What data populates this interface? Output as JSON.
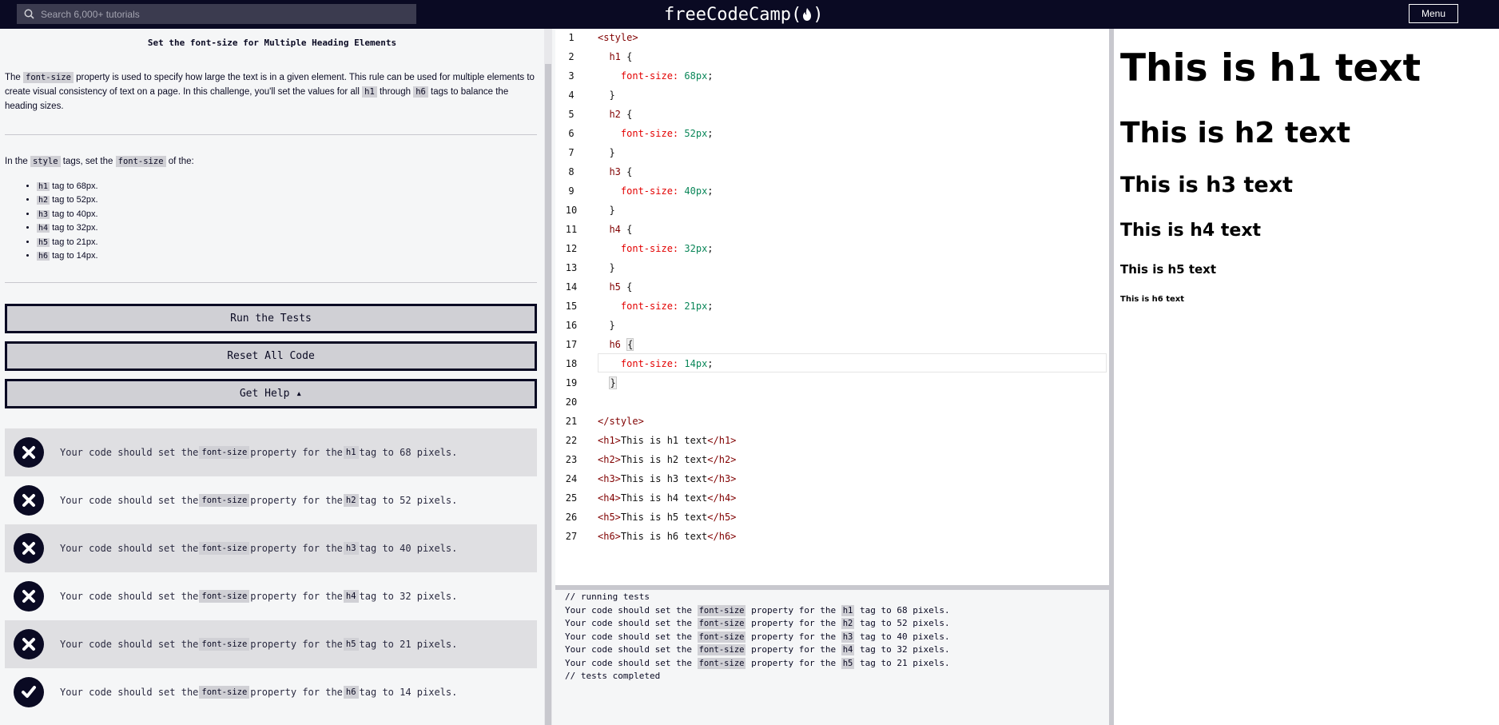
{
  "navbar": {
    "search_placeholder": "Search 6,000+ tutorials",
    "logo_text_left": "freeCodeCamp(",
    "logo_text_right": ")",
    "menu_label": "Menu"
  },
  "challenge": {
    "title": "Set the font-size for Multiple Heading Elements",
    "intro": {
      "t1": "The ",
      "c1": "font-size",
      "t2": " property is used to specify how large the text is in a given element. This rule can be used for multiple elements to create visual consistency of text on a page. In this challenge, you'll set the values for all ",
      "c2": "h1",
      "t3": " through ",
      "c3": "h6",
      "t4": " tags to balance the heading sizes."
    },
    "instruction": {
      "t1": "In the ",
      "c1": "style",
      "t2": " tags, set the ",
      "c2": "font-size",
      "t3": " of the:"
    },
    "tasks": [
      {
        "tag": "h1",
        "text": " tag to 68px."
      },
      {
        "tag": "h2",
        "text": " tag to 52px."
      },
      {
        "tag": "h3",
        "text": " tag to 40px."
      },
      {
        "tag": "h4",
        "text": " tag to 32px."
      },
      {
        "tag": "h5",
        "text": " tag to 21px."
      },
      {
        "tag": "h6",
        "text": " tag to 14px."
      }
    ]
  },
  "buttons": {
    "run": "Run the Tests",
    "reset": "Reset All Code",
    "help": "Get Help ▴"
  },
  "tests": [
    {
      "pre": "Your code should set the ",
      "prop": "font-size",
      "mid": " property for the ",
      "tag": "h1",
      "post": " tag to 68 pixels.",
      "status": "fail"
    },
    {
      "pre": "Your code should set the ",
      "prop": "font-size",
      "mid": " property for the ",
      "tag": "h2",
      "post": " tag to 52 pixels.",
      "status": "fail"
    },
    {
      "pre": "Your code should set the ",
      "prop": "font-size",
      "mid": " property for the ",
      "tag": "h3",
      "post": " tag to 40 pixels.",
      "status": "fail"
    },
    {
      "pre": "Your code should set the ",
      "prop": "font-size",
      "mid": " property for the ",
      "tag": "h4",
      "post": " tag to 32 pixels.",
      "status": "fail"
    },
    {
      "pre": "Your code should set the ",
      "prop": "font-size",
      "mid": " property for the ",
      "tag": "h5",
      "post": " tag to 21 pixels.",
      "status": "fail"
    },
    {
      "pre": "Your code should set the ",
      "prop": "font-size",
      "mid": " property for the ",
      "tag": "h6",
      "post": " tag to 14 pixels.",
      "status": "pass"
    }
  ],
  "editor": {
    "line_numbers": [
      "1",
      "2",
      "3",
      "4",
      "5",
      "6",
      "7",
      "8",
      "9",
      "10",
      "11",
      "12",
      "13",
      "14",
      "15",
      "16",
      "17",
      "18",
      "19",
      "20",
      "21",
      "22",
      "23",
      "24",
      "25",
      "26",
      "27"
    ],
    "style_open": "<style>",
    "style_close": "</style>",
    "rules": [
      {
        "sel": "h1",
        "prop": "font-size:",
        "val": "68px"
      },
      {
        "sel": "h2",
        "prop": "font-size:",
        "val": "52px"
      },
      {
        "sel": "h3",
        "prop": "font-size:",
        "val": "40px"
      },
      {
        "sel": "h4",
        "prop": "font-size:",
        "val": "32px"
      },
      {
        "sel": "h5",
        "prop": "font-size:",
        "val": "21px"
      },
      {
        "sel": "h6",
        "prop": "font-size:",
        "val": "14px"
      }
    ],
    "open_brace": "{",
    "close_brace": "}",
    "semicolon": ";",
    "html_lines": [
      {
        "open": "<h1>",
        "text": "This is h1 text",
        "close": "</h1>"
      },
      {
        "open": "<h2>",
        "text": "This is h2 text",
        "close": "</h2>"
      },
      {
        "open": "<h3>",
        "text": "This is h3 text",
        "close": "</h3>"
      },
      {
        "open": "<h4>",
        "text": "This is h4 text",
        "close": "</h4>"
      },
      {
        "open": "<h5>",
        "text": "This is h5 text",
        "close": "</h5>"
      },
      {
        "open": "<h6>",
        "text": "This is h6 text",
        "close": "</h6>"
      }
    ]
  },
  "console": {
    "start": "// running tests",
    "lines": [
      {
        "pre": "Your code should set the ",
        "prop": "font-size",
        "mid": " property for the ",
        "tag": "h1",
        "post": " tag to 68 pixels."
      },
      {
        "pre": "Your code should set the ",
        "prop": "font-size",
        "mid": " property for the ",
        "tag": "h2",
        "post": " tag to 52 pixels."
      },
      {
        "pre": "Your code should set the ",
        "prop": "font-size",
        "mid": " property for the ",
        "tag": "h3",
        "post": " tag to 40 pixels."
      },
      {
        "pre": "Your code should set the ",
        "prop": "font-size",
        "mid": " property for the ",
        "tag": "h4",
        "post": " tag to 32 pixels."
      },
      {
        "pre": "Your code should set the ",
        "prop": "font-size",
        "mid": " property for the ",
        "tag": "h5",
        "post": " tag to 21 pixels."
      }
    ],
    "end": "// tests completed"
  },
  "preview": {
    "h1": "This is h1 text",
    "h2": "This is h2 text",
    "h3": "This is h3 text",
    "h4": "This is h4 text",
    "h5": "This is h5 text",
    "h6": "This is h6 text"
  },
  "colors": {
    "nav_bg": "#0a0a23",
    "code_bg": "#d0d0d5",
    "tag_color": "#800000",
    "prop_color": "#e30000",
    "value_color": "#098658"
  }
}
